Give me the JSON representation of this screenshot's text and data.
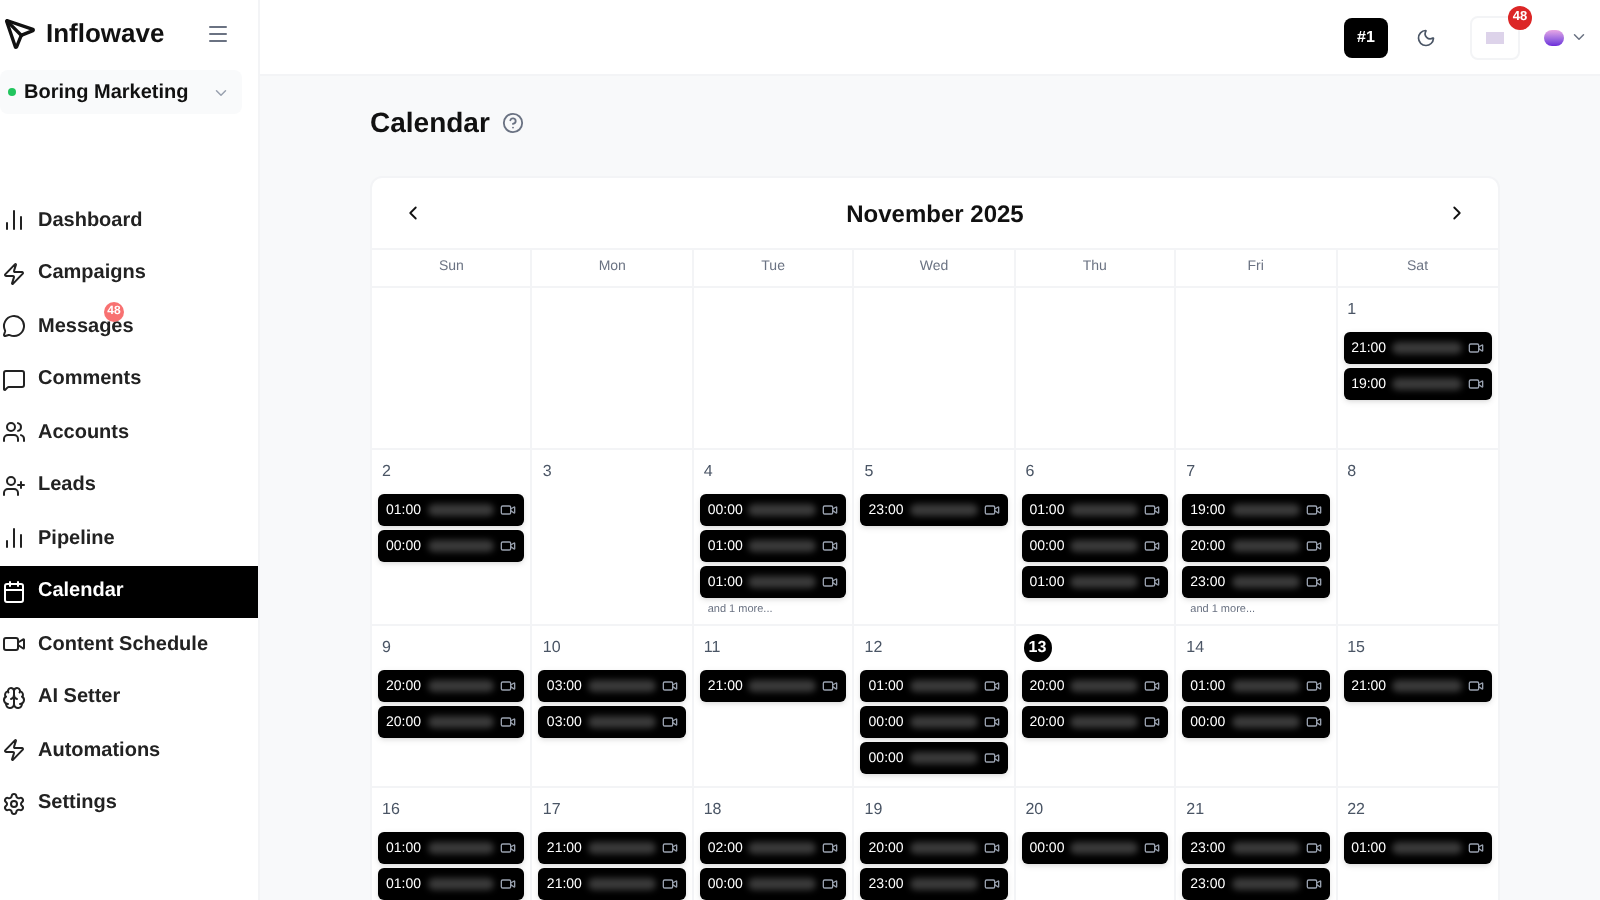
{
  "brand": {
    "name": "Inflowave"
  },
  "workspace": {
    "name": "Boring Marketing",
    "color": "#22c55e"
  },
  "sidebar": {
    "items": [
      {
        "label": "Dashboard",
        "selected": false
      },
      {
        "label": "Campaigns",
        "selected": false
      },
      {
        "label": "Messages",
        "selected": false,
        "badge": "48"
      },
      {
        "label": "Comments",
        "selected": false
      },
      {
        "label": "Accounts",
        "selected": false
      },
      {
        "label": "Leads",
        "selected": false
      },
      {
        "label": "Pipeline",
        "selected": false
      },
      {
        "label": "Calendar",
        "selected": true
      },
      {
        "label": "Content Schedule",
        "selected": false
      },
      {
        "label": "AI Setter",
        "selected": false
      },
      {
        "label": "Automations",
        "selected": false
      },
      {
        "label": "Settings",
        "selected": false
      }
    ]
  },
  "header": {
    "rank": "#1",
    "notifications": "48"
  },
  "page": {
    "title": "Calendar"
  },
  "calendar": {
    "month": "November 2025",
    "weekdays": [
      "Sun",
      "Mon",
      "Tue",
      "Wed",
      "Thu",
      "Fri",
      "Sat"
    ],
    "weeks": [
      {
        "days": [
          {
            "day": "1",
            "today": false,
            "events": [
              {
                "time": "21:00"
              },
              {
                "time": "19:00"
              }
            ]
          }
        ]
      },
      {
        "days": [
          {
            "day": "2",
            "today": false,
            "events": [
              {
                "time": "01:00"
              },
              {
                "time": "00:00"
              }
            ]
          },
          {
            "day": "3",
            "today": false
          },
          {
            "day": "4",
            "today": false,
            "events": [
              {
                "time": "00:00"
              },
              {
                "time": "01:00"
              },
              {
                "time": "01:00"
              }
            ],
            "more": "and 1 more..."
          },
          {
            "day": "5",
            "today": false,
            "events": [
              {
                "time": "23:00"
              }
            ]
          },
          {
            "day": "6",
            "today": false,
            "events": [
              {
                "time": "01:00"
              },
              {
                "time": "00:00"
              },
              {
                "time": "01:00"
              }
            ]
          },
          {
            "day": "7",
            "today": false,
            "events": [
              {
                "time": "19:00"
              },
              {
                "time": "20:00"
              },
              {
                "time": "23:00"
              }
            ],
            "more": "and 1 more..."
          },
          {
            "day": "8",
            "today": false
          }
        ]
      },
      {
        "days": [
          {
            "day": "9",
            "today": false,
            "events": [
              {
                "time": "20:00"
              },
              {
                "time": "20:00"
              }
            ]
          },
          {
            "day": "10",
            "today": false,
            "events": [
              {
                "time": "03:00"
              },
              {
                "time": "03:00"
              }
            ]
          },
          {
            "day": "11",
            "today": false,
            "events": [
              {
                "time": "21:00"
              }
            ]
          },
          {
            "day": "12",
            "today": false,
            "events": [
              {
                "time": "01:00"
              },
              {
                "time": "00:00"
              },
              {
                "time": "00:00"
              }
            ]
          },
          {
            "day": "13",
            "today": true,
            "events": [
              {
                "time": "20:00"
              },
              {
                "time": "20:00"
              }
            ]
          },
          {
            "day": "14",
            "today": false,
            "events": [
              {
                "time": "01:00"
              },
              {
                "time": "00:00"
              }
            ]
          },
          {
            "day": "15",
            "today": false,
            "events": [
              {
                "time": "21:00"
              }
            ]
          }
        ]
      },
      {
        "days": [
          {
            "day": "16",
            "today": false,
            "events": [
              {
                "time": "01:00"
              },
              {
                "time": "01:00"
              }
            ]
          },
          {
            "day": "17",
            "today": false,
            "events": [
              {
                "time": "21:00"
              },
              {
                "time": "21:00"
              }
            ]
          },
          {
            "day": "18",
            "today": false,
            "events": [
              {
                "time": "02:00"
              },
              {
                "time": "00:00"
              }
            ]
          },
          {
            "day": "19",
            "today": false,
            "events": [
              {
                "time": "20:00"
              },
              {
                "time": "23:00"
              }
            ]
          },
          {
            "day": "20",
            "today": false,
            "events": [
              {
                "time": "00:00"
              }
            ]
          },
          {
            "day": "21",
            "today": false,
            "events": [
              {
                "time": "23:00"
              },
              {
                "time": "23:00"
              }
            ]
          },
          {
            "day": "22",
            "today": false,
            "events": [
              {
                "time": "01:00"
              }
            ]
          }
        ]
      }
    ]
  }
}
